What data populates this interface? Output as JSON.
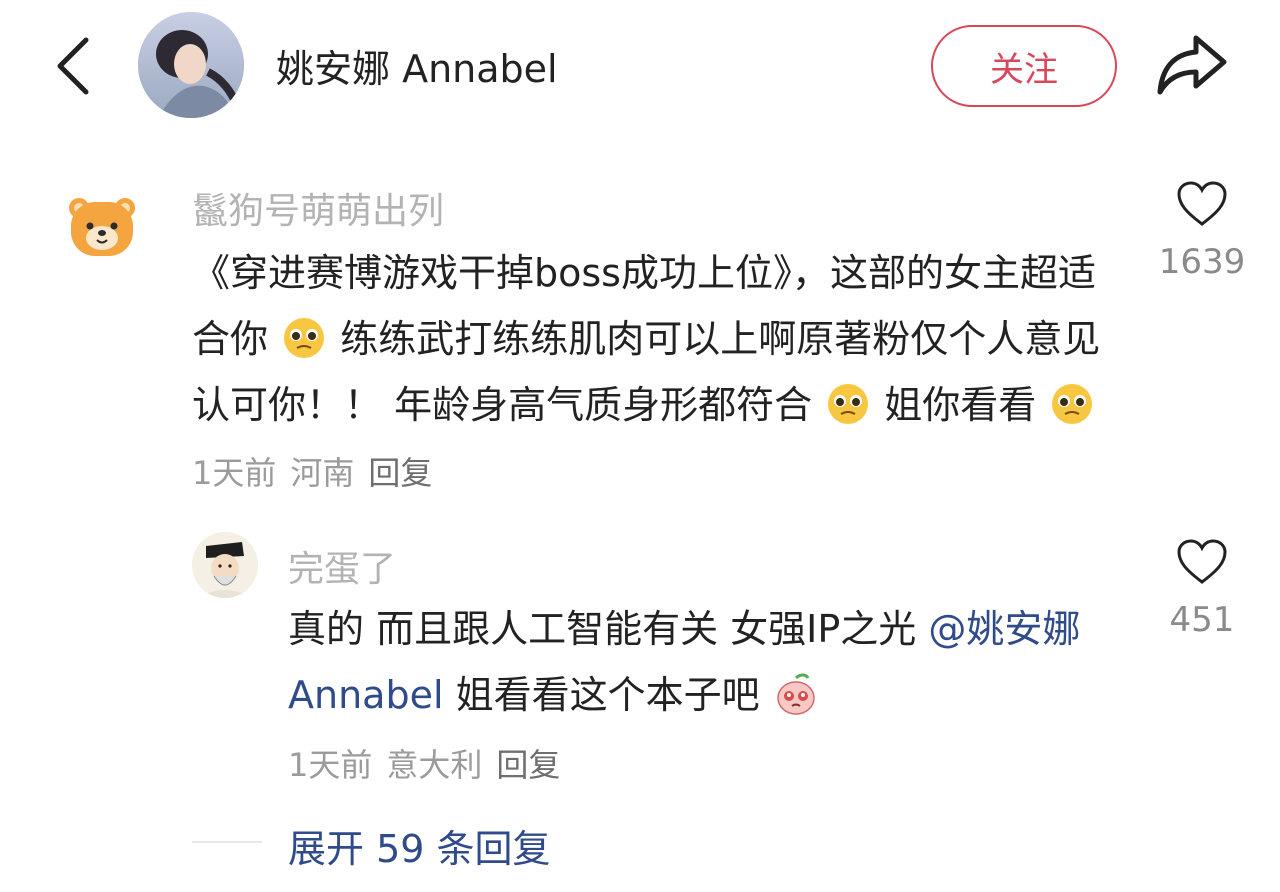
{
  "header": {
    "author_name": "姚安娜 Annabel",
    "follow_label": "关注"
  },
  "comments": [
    {
      "username": "鬣狗号萌萌出列",
      "text_parts": [
        "《穿进赛博游戏干掉boss成功上位》，这部的女主超适合你",
        "练练武打练练肌肉可以上啊原著粉仅个人意见认可你！！ 年龄身高气质身形都符合",
        "姐你看看"
      ],
      "time": "1天前",
      "location": "河南",
      "reply_label": "回复",
      "likes": "1639",
      "emoji": "pleading-face-icon"
    },
    {
      "username": "完蛋了",
      "text_before": "真的 而且跟人工智能有关 女强IP之光 ",
      "mention": "@姚安娜Annabel",
      "text_after": " 姐看看这个本子吧",
      "time": "1天前",
      "location": "意大利",
      "reply_label": "回复",
      "likes": "451",
      "emoji": "peach-crying-icon"
    }
  ],
  "expand_label": "展开 59 条回复",
  "colors": {
    "accent_red": "#d9475a",
    "link_blue": "#2f4b8c",
    "muted_gray": "#9b9b9b"
  }
}
